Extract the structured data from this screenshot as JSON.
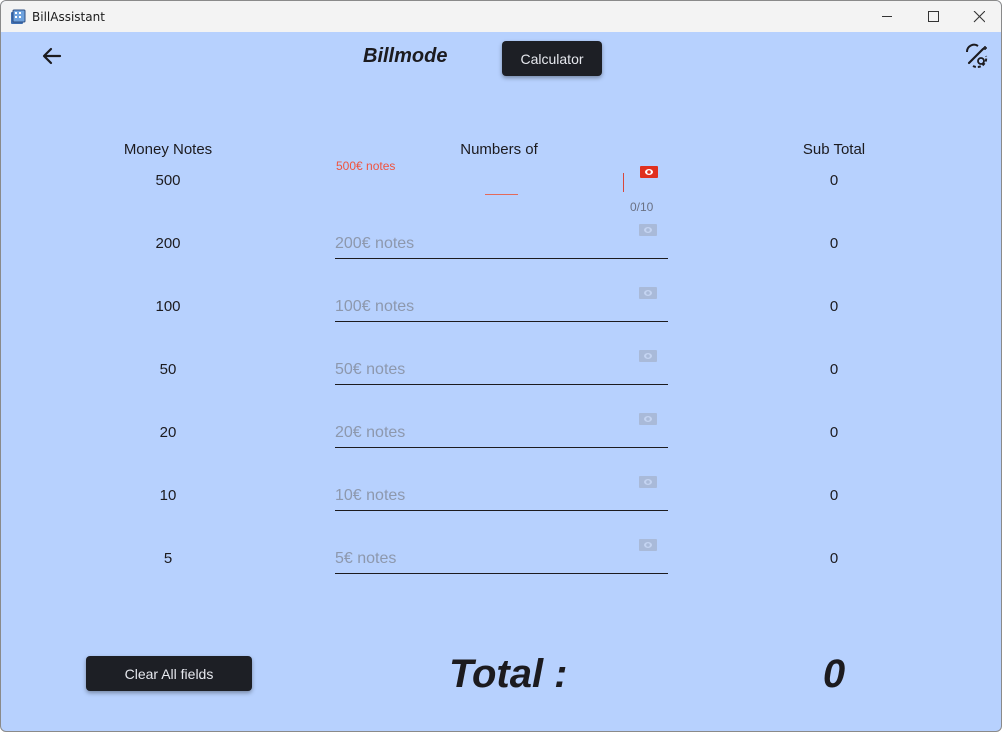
{
  "window": {
    "title": "BillAssistant"
  },
  "appbar": {
    "title": "Billmode",
    "calculator_label": "Calculator"
  },
  "headers": {
    "money_notes": "Money Notes",
    "numbers_of": "Numbers of",
    "sub_total": "Sub Total"
  },
  "rows": [
    {
      "denomination": "500",
      "placeholder": "500€ notes",
      "counter": "0/10",
      "subtotal": "0"
    },
    {
      "denomination": "200",
      "placeholder": "200€ notes",
      "subtotal": "0"
    },
    {
      "denomination": "100",
      "placeholder": "100€ notes",
      "subtotal": "0"
    },
    {
      "denomination": "50",
      "placeholder": "50€ notes",
      "subtotal": "0"
    },
    {
      "denomination": "20",
      "placeholder": "20€ notes",
      "subtotal": "0"
    },
    {
      "denomination": "10",
      "placeholder": "10€ notes",
      "subtotal": "0"
    },
    {
      "denomination": "5",
      "placeholder": "5€ notes",
      "subtotal": "0"
    }
  ],
  "footer": {
    "clear_label": "Clear All fields",
    "total_label": "Total :",
    "total_value": "0"
  },
  "colors": {
    "background": "#b7d1fe",
    "button": "#1d1f25",
    "error": "#f0533e",
    "icon_muted": "#a9bad9"
  },
  "icons": {
    "back": "arrow-left-icon",
    "theme": "auto-mode-icon",
    "note": "banknote-icon",
    "minimize": "minimize-icon",
    "maximize": "maximize-icon",
    "close": "close-icon"
  }
}
